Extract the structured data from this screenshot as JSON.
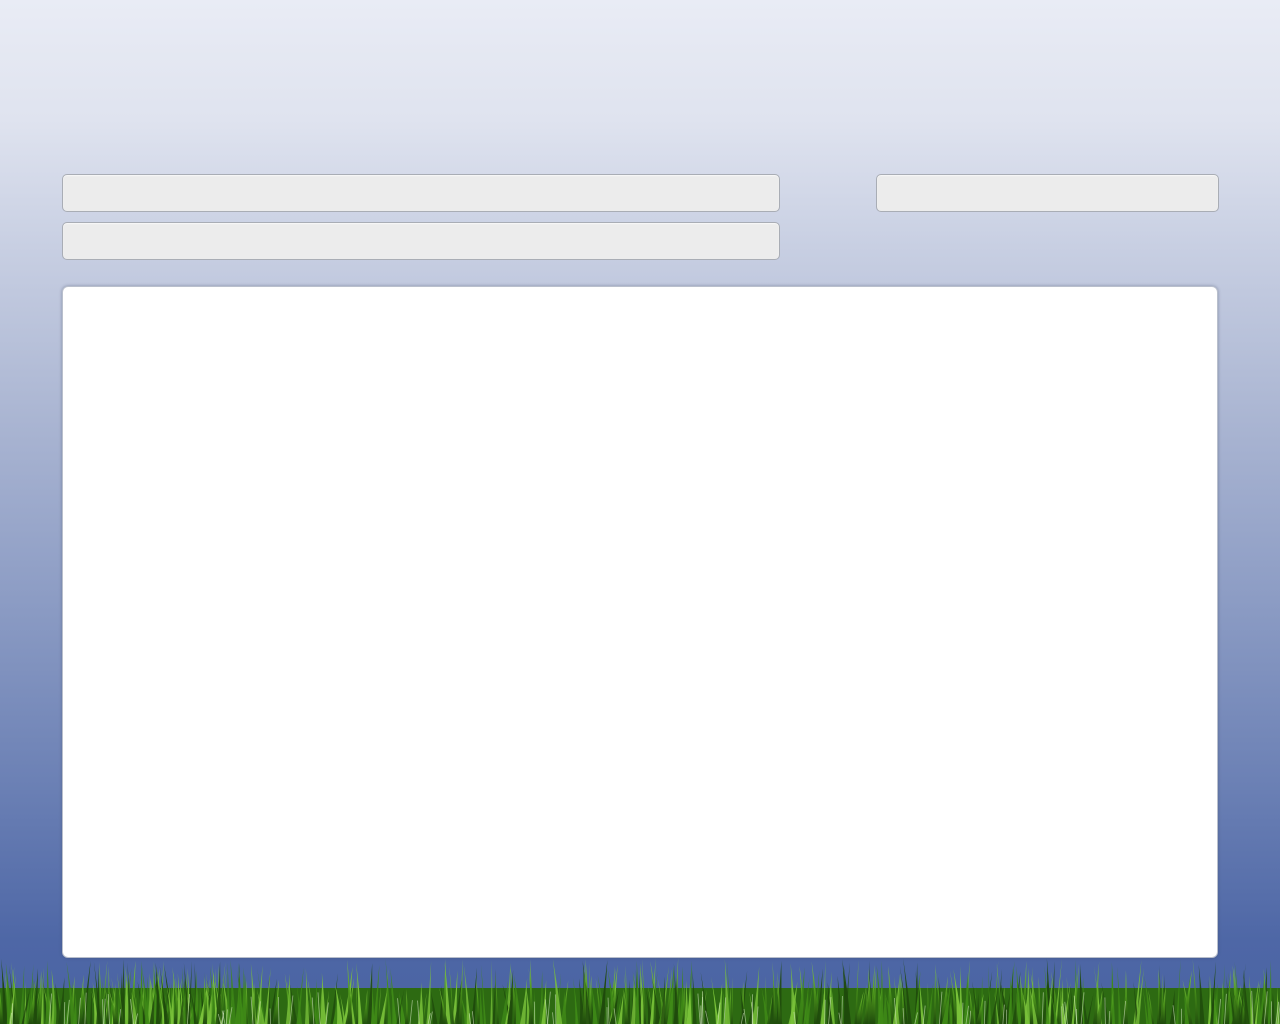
{
  "fields": {
    "top_left": {
      "value": ""
    },
    "second_left": {
      "value": ""
    },
    "top_right": {
      "value": ""
    }
  },
  "panel": {
    "content": ""
  },
  "background": {
    "sky_top_color": "#e9ecf5",
    "sky_bottom_color": "#4a63a3",
    "grass_dark_color": "#1f4a0c",
    "grass_light_color": "#7ac23a"
  },
  "icons": {
    "grass": "grass-decoration"
  }
}
